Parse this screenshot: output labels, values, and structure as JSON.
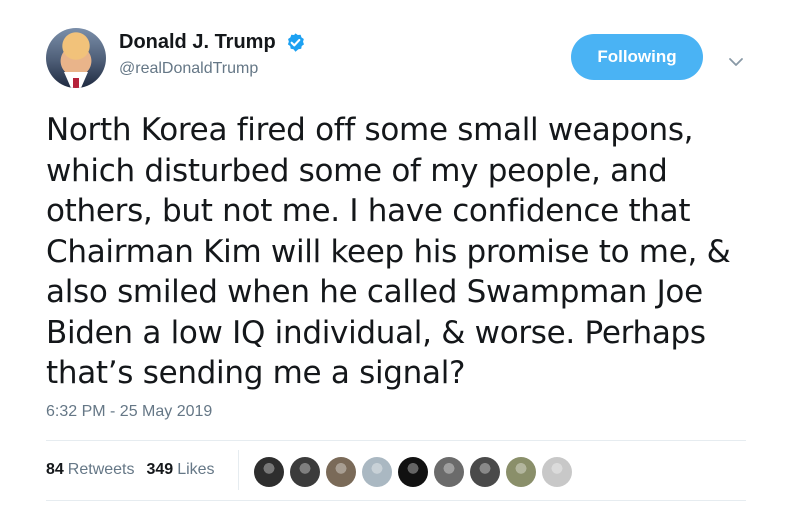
{
  "author": {
    "display_name": "Donald J. Trump",
    "handle": "@realDonaldTrump",
    "verified": true,
    "avatar": "profile-photo"
  },
  "follow_button": {
    "label": "Following"
  },
  "menu": {
    "icon": "chevron-down-icon"
  },
  "tweet": {
    "text": "North Korea fired off some small weapons, which disturbed some of my people, and others, but not me. I have confidence that Chairman Kim will keep his promise to me, & also smiled when he called Swampman Joe Biden a low IQ individual, & worse. Perhaps that’s sending me a signal?",
    "timestamp": "6:32 PM - 25 May 2019"
  },
  "stats": {
    "retweets_count": "84",
    "retweets_label": "Retweets",
    "likes_count": "349",
    "likes_label": "Likes"
  },
  "likers": [
    {
      "name": "liker-1",
      "color": "#2e2e2e"
    },
    {
      "name": "liker-2",
      "color": "#3b3b3b"
    },
    {
      "name": "liker-3",
      "color": "#7a6a58"
    },
    {
      "name": "liker-4",
      "color": "#aab8c2"
    },
    {
      "name": "liker-5",
      "color": "#111111"
    },
    {
      "name": "liker-6",
      "color": "#6b6b6b"
    },
    {
      "name": "liker-7",
      "color": "#4a4a4a"
    },
    {
      "name": "liker-8",
      "color": "#8a8f6a"
    },
    {
      "name": "liker-9",
      "color": "#c8c8c8"
    }
  ],
  "colors": {
    "accent": "#4ab3f4",
    "verified_badge": "#1da1f2",
    "secondary_text": "#657786"
  }
}
